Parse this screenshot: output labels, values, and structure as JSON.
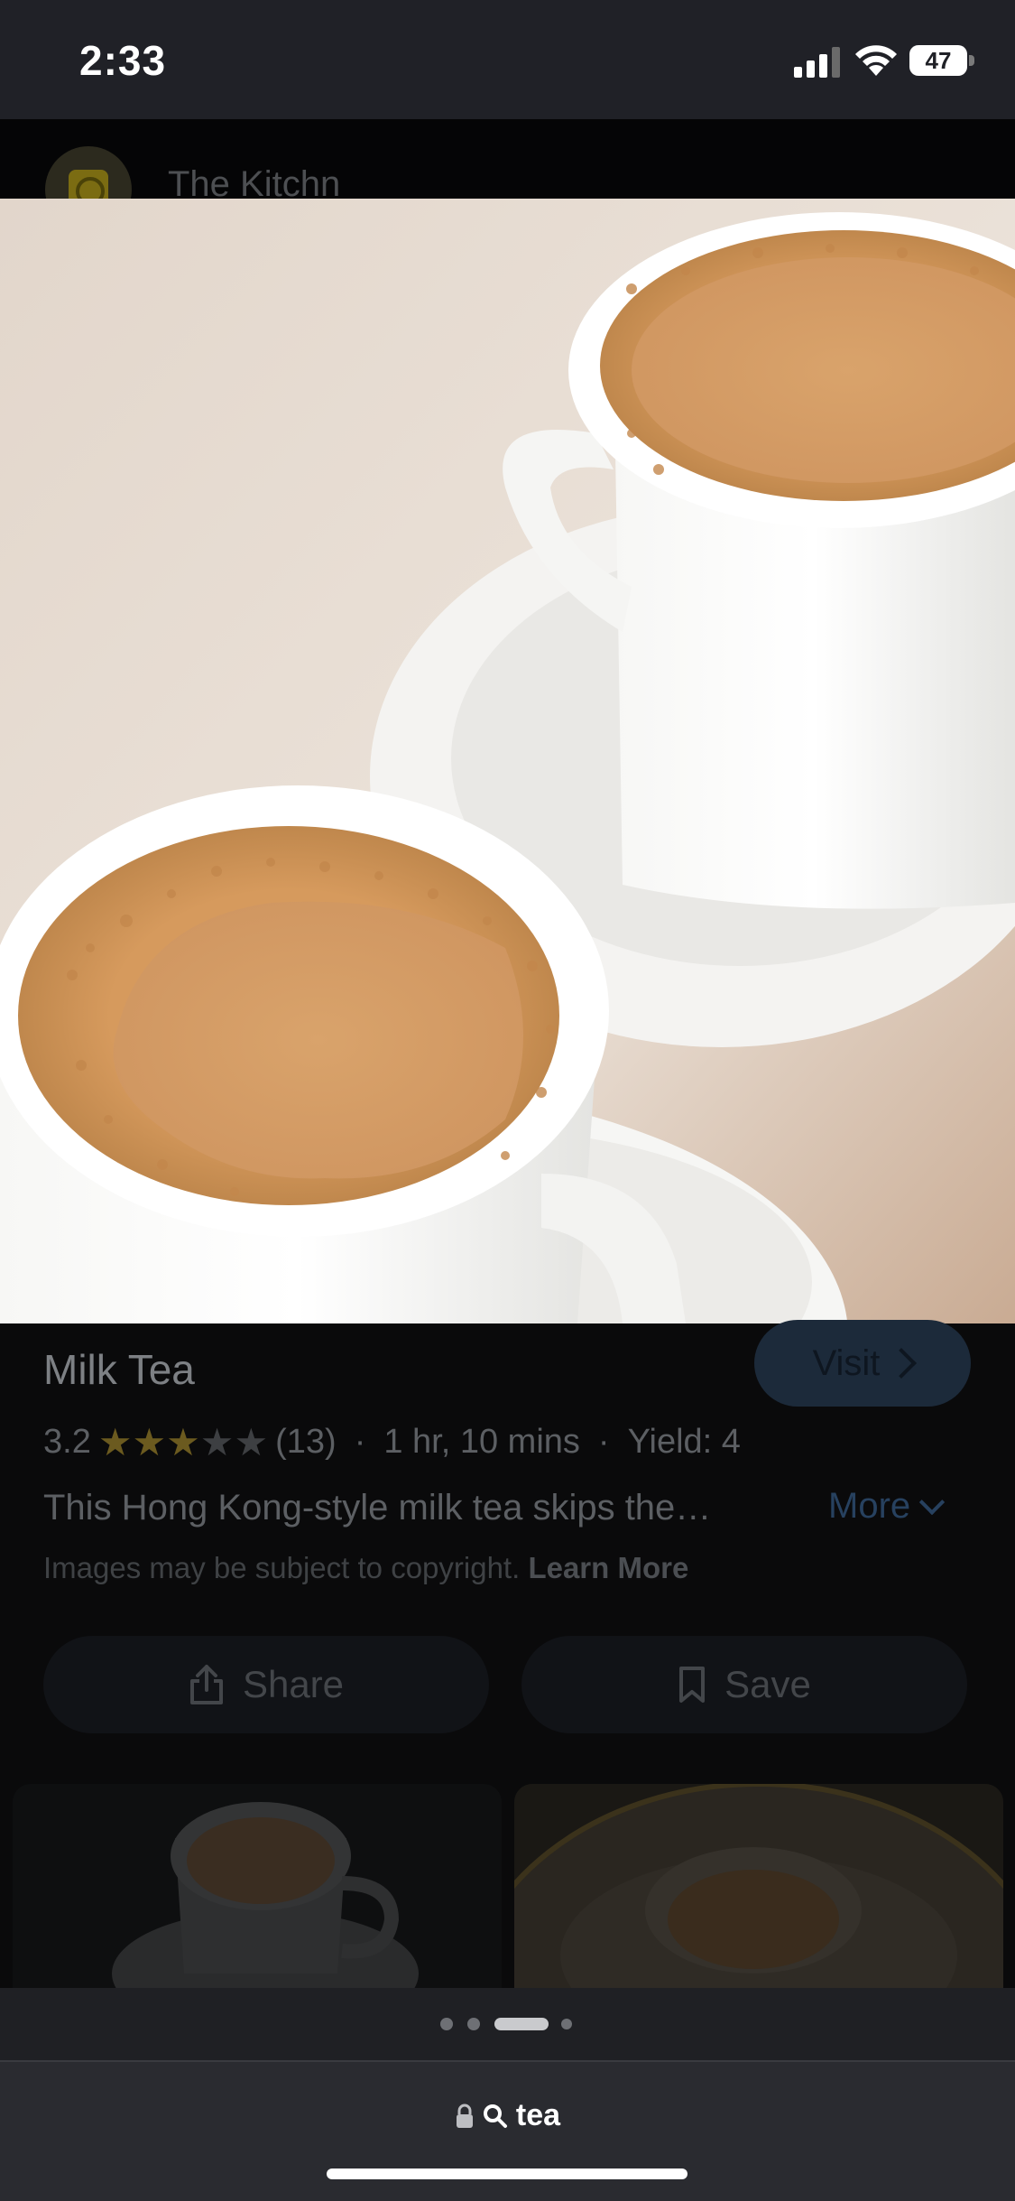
{
  "status_bar": {
    "time": "2:33",
    "battery": "47"
  },
  "source": {
    "site_name": "The Kitchn"
  },
  "result": {
    "title": "Milk Tea",
    "visit_label": "Visit",
    "rating": "3.2",
    "rating_stars": 3,
    "reviews": "(13)",
    "time": "1 hr, 10 mins",
    "yield": "Yield: 4",
    "description": "This Hong Kong-style milk tea skips the…",
    "more_label": "More",
    "copyright_text": "Images may be subject to copyright.",
    "learn_more": "Learn More"
  },
  "actions": {
    "share_label": "Share",
    "save_label": "Save"
  },
  "address_bar": {
    "query": "tea"
  },
  "colors": {
    "accent": "#27415f",
    "star": "#6b5a1f"
  }
}
